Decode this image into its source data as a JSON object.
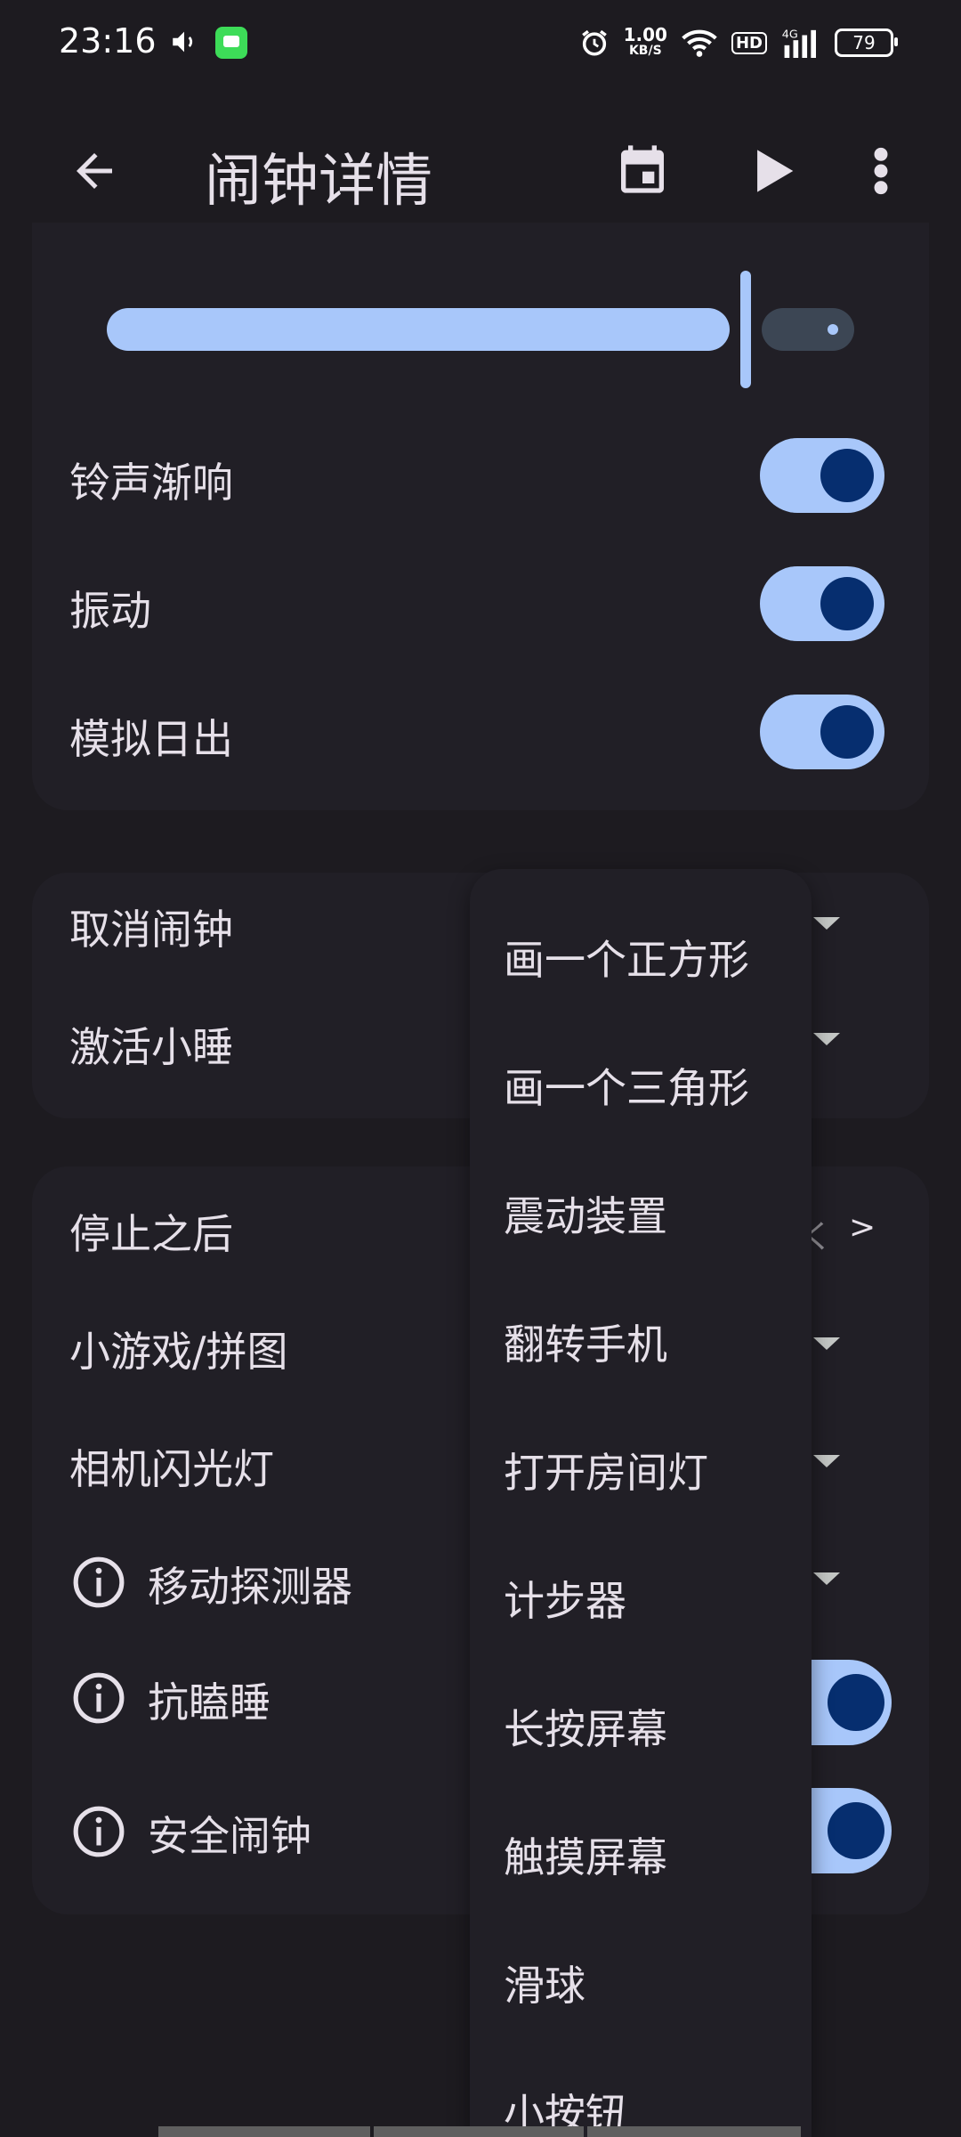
{
  "status_bar": {
    "time": "23:16",
    "net_speed": "1.00",
    "net_unit": "KB/S",
    "hd": "HD",
    "network": "4G",
    "battery": "79"
  },
  "app_bar": {
    "title": "闹钟详情"
  },
  "volume_slider": {
    "value_fraction": 0.85
  },
  "toggles_top": [
    {
      "label": "铃声渐响",
      "on": true
    },
    {
      "label": "振动",
      "on": true
    },
    {
      "label": "模拟日出",
      "on": true
    }
  ],
  "dropdown_rows": [
    {
      "label": "取消闹钟"
    },
    {
      "label": "激活小睡"
    }
  ],
  "settings": {
    "after_stop": {
      "label": "停止之后",
      "chevron": ">"
    },
    "mini_game": {
      "label": "小游戏/拼图"
    },
    "flash": {
      "label": "相机闪光灯"
    },
    "motion": {
      "label": "移动探测器"
    },
    "anti_sleep": {
      "label": "抗瞌睡",
      "on": true
    },
    "safe_alarm": {
      "label": "安全闹钟",
      "on": true
    }
  },
  "menu_items": [
    "画一个正方形",
    "画一个三角形",
    "震动装置",
    "翻转手机",
    "打开房间灯",
    "计步器",
    "长按屏幕",
    "触摸屏幕",
    "滑球",
    "小按钮"
  ],
  "colors": {
    "background": "#1d1b20",
    "card": "#211f26",
    "accent": "#a8c7fa",
    "knob": "#062e6f"
  }
}
